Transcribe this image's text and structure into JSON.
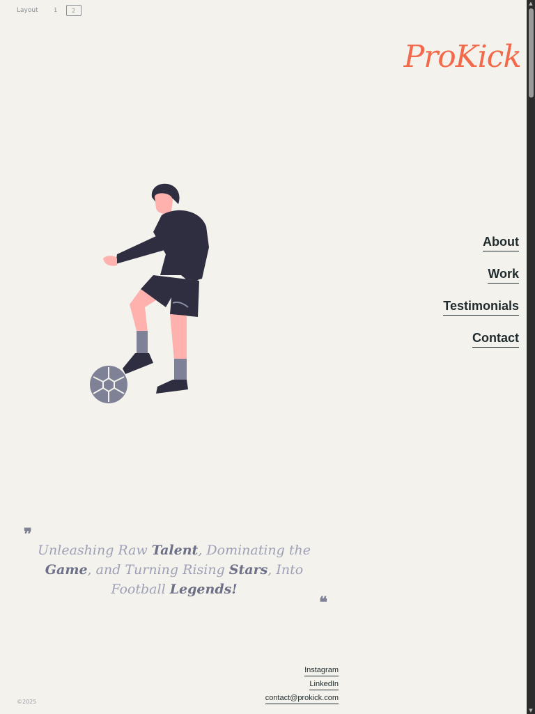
{
  "layout_switch": {
    "label": "Layout",
    "options": [
      "1",
      "2"
    ],
    "selected": "2"
  },
  "brand": {
    "logo": "ProKick"
  },
  "nav": {
    "items": [
      "About",
      "Work",
      "Testimonials",
      "Contact"
    ]
  },
  "quote": {
    "parts": [
      {
        "text": "Unleashing Raw ",
        "em": false
      },
      {
        "text": "Talent",
        "em": true
      },
      {
        "text": ", Dominating the ",
        "em": false
      },
      {
        "text": "Game",
        "em": true
      },
      {
        "text": ", and Turning Rising ",
        "em": false
      },
      {
        "text": "Stars",
        "em": true
      },
      {
        "text": ", Into Football ",
        "em": false
      },
      {
        "text": "Legends!",
        "em": true
      }
    ],
    "open_mark": "❞",
    "close_mark": "❝"
  },
  "socials": {
    "instagram": "Instagram",
    "linkedin": "LinkedIn",
    "email": "contact@prokick.com"
  },
  "footer": {
    "copyright": "©2025"
  },
  "colors": {
    "background": "#f3f2ed",
    "accent": "#f26a4b",
    "text": "#1f2a2c",
    "quote": "#9ea0b6"
  }
}
